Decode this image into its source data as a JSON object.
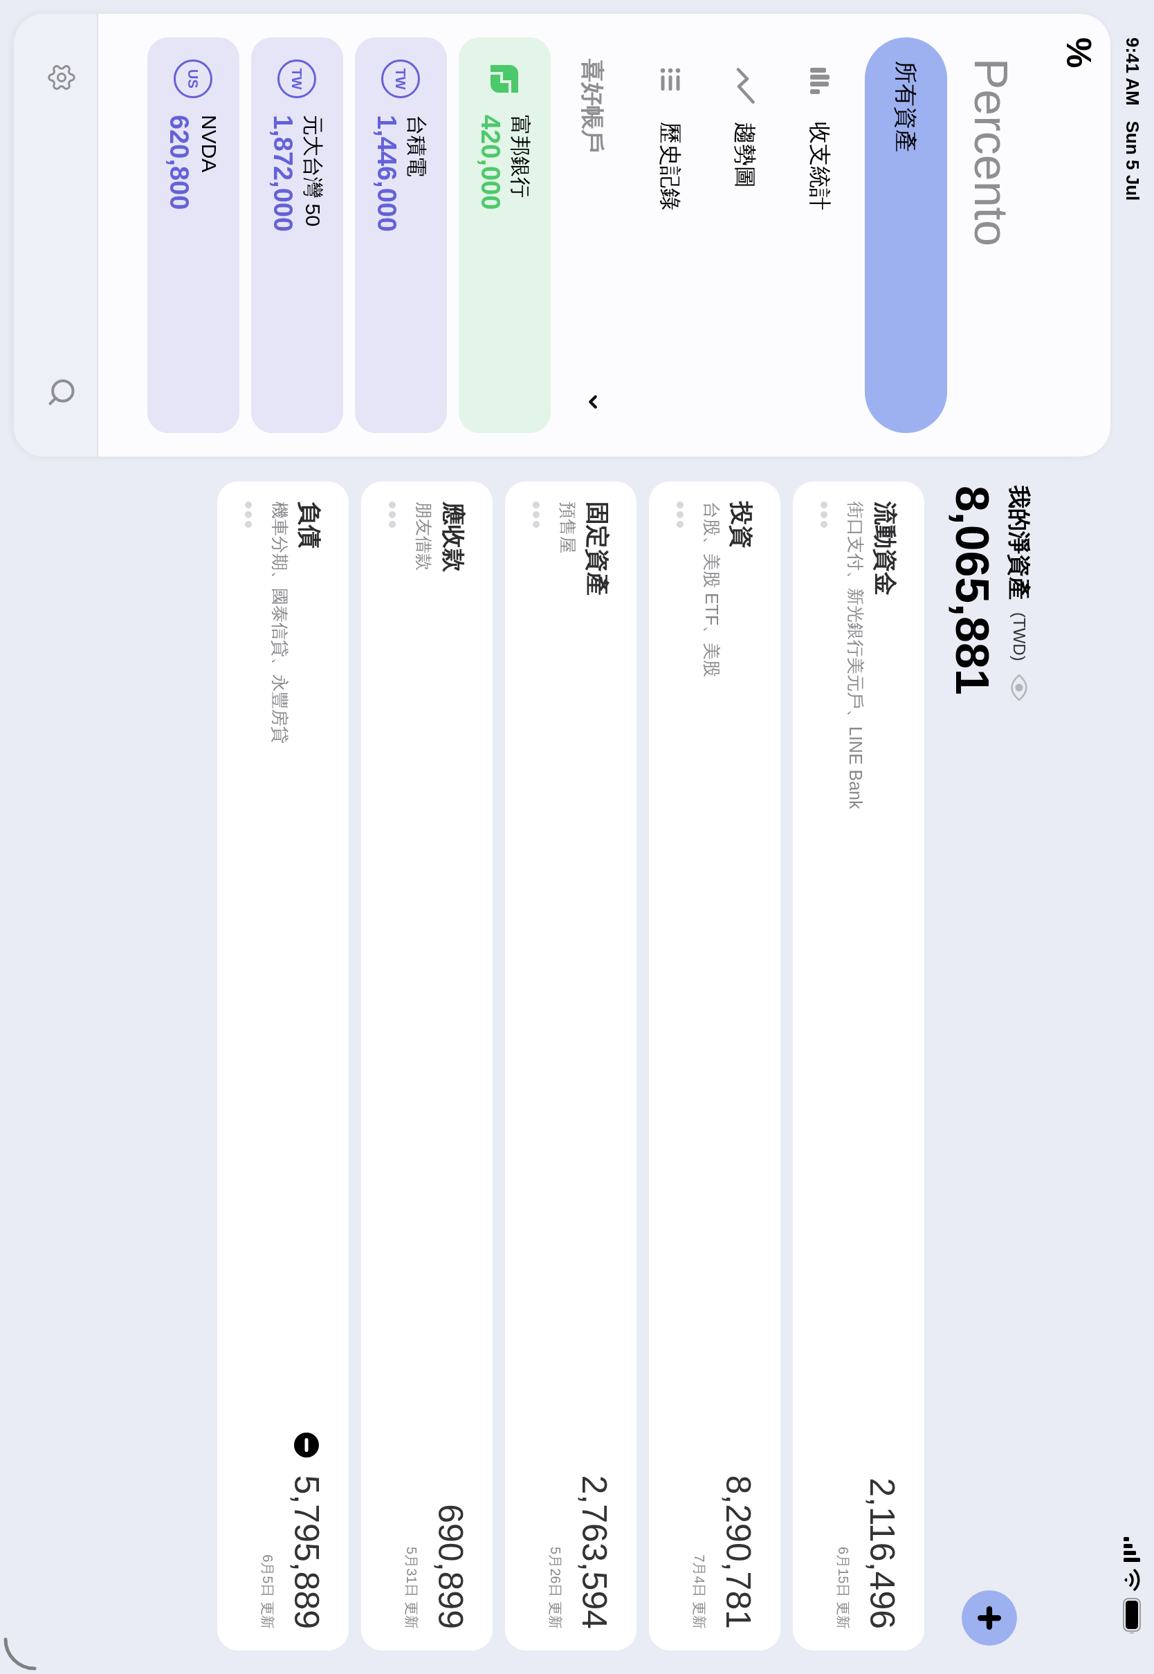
{
  "status_bar": {
    "time": "9:41 AM",
    "date": "Sun 5 Jul"
  },
  "sidebar": {
    "logo": "%",
    "title": "Percento",
    "nav": [
      {
        "label": "所有資產",
        "selected": true
      },
      {
        "label": "收支統計",
        "selected": false
      },
      {
        "label": "趨勢圖",
        "selected": false
      },
      {
        "label": "歷史記錄",
        "selected": false
      }
    ],
    "favorites": {
      "title": "喜好帳戶",
      "expanded": true,
      "items": [
        {
          "kind": "bank",
          "name": "富邦銀行",
          "value": "420,000"
        },
        {
          "kind": "stock",
          "badge": "TW",
          "name": "台積電",
          "value": "1,446,000"
        },
        {
          "kind": "stock",
          "badge": "TW",
          "name": "元大台灣 50",
          "value": "1,872,000"
        },
        {
          "kind": "stock",
          "badge": "US",
          "name": "NVDA",
          "value": "620,800"
        }
      ]
    }
  },
  "net_worth": {
    "label": "我的淨資產",
    "currency": "(TWD)",
    "value": "8,065,881"
  },
  "categories": [
    {
      "title": "流動資金",
      "accounts": "街口支付、新光銀行美元戶、LINE Bank",
      "value": "2,116,496",
      "updated": "6月15日 更新",
      "negative": false
    },
    {
      "title": "投資",
      "accounts": "台股、美股 ETF、美股",
      "value": "8,290,781",
      "updated": "7月4日 更新",
      "negative": false
    },
    {
      "title": "固定資產",
      "accounts": "預售屋",
      "value": "2,763,594",
      "updated": "5月26日 更新",
      "negative": false
    },
    {
      "title": "應收款",
      "accounts": "朋友借款",
      "value": "690,899",
      "updated": "5月31日 更新",
      "negative": false
    },
    {
      "title": "負債",
      "accounts": "機車分期、國泰信貸、永豐房貸",
      "value": "5,795,889",
      "updated": "6月5日 更新",
      "negative": true
    }
  ]
}
